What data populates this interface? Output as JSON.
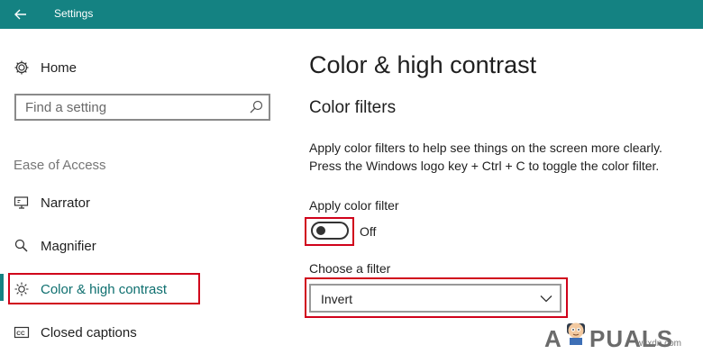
{
  "window": {
    "title": "Settings"
  },
  "sidebar": {
    "home_label": "Home",
    "search_placeholder": "Find a setting",
    "section_label": "Ease of Access",
    "items": [
      {
        "label": "Narrator",
        "icon": "narrator-icon"
      },
      {
        "label": "Magnifier",
        "icon": "magnifier-icon"
      },
      {
        "label": "Color & high contrast",
        "icon": "brightness-icon",
        "selected": true
      },
      {
        "label": "Closed captions",
        "icon": "closed-captions-icon"
      }
    ]
  },
  "main": {
    "title": "Color & high contrast",
    "section_title": "Color filters",
    "description_line1": "Apply color filters to help see things on the screen more clearly.",
    "description_line2": "Press the Windows logo key + Ctrl + C to toggle the color filter.",
    "apply_filter_label": "Apply color filter",
    "toggle_state": "Off",
    "choose_filter_label": "Choose a filter",
    "filter_value": "Invert"
  },
  "watermark": {
    "brand_a": "A",
    "brand_rest": "PUALS",
    "site": "wsxdn.com"
  },
  "colors": {
    "accent": "#148282",
    "highlight": "#d0021b"
  }
}
